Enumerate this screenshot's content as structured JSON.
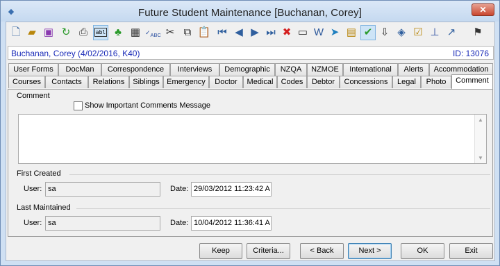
{
  "window": {
    "title": "Future Student Maintenance  [Buchanan, Corey]"
  },
  "toolbar": {
    "icons": [
      "new-document-icon",
      "open-folder-icon",
      "save-icon",
      "refresh-icon",
      "print-icon",
      "abl-icon",
      "tree-icon",
      "calculator-icon",
      "spellcheck-icon",
      "cut-icon",
      "copy-icon",
      "paste-icon",
      "first-record-icon",
      "previous-record-icon",
      "next-record-icon",
      "last-record-icon",
      "delete-icon",
      "card-icon",
      "word-icon",
      "forward-icon",
      "clipboard-icon",
      "approve-icon",
      "download-icon",
      "tag-icon",
      "checklist-icon",
      "pin-icon",
      "link-arrow-icon",
      "flag-icon"
    ],
    "abl_label": "abl"
  },
  "student": {
    "name": "Buchanan, Corey (4/02/2016, K40)",
    "id": "ID: 13076"
  },
  "tabs": {
    "row1": [
      "User Forms",
      "DocMan",
      "Correspondence",
      "Interviews",
      "Demographic",
      "NZQA",
      "NZMOE",
      "International",
      "Alerts",
      "Accommodation"
    ],
    "row2": [
      "Courses",
      "Contacts",
      "Relations",
      "Siblings",
      "Emergency",
      "Doctor",
      "Medical",
      "Codes",
      "Debtor",
      "Concessions",
      "Legal",
      "Photo",
      "Comment"
    ],
    "active": "Comment"
  },
  "comment": {
    "section_label": "Comment",
    "checkbox_label": "Show Important Comments Message",
    "checkbox_checked": false,
    "text": ""
  },
  "first_created": {
    "section_label": "First Created",
    "user_label": "User:",
    "user_value": "sa",
    "date_label": "Date:",
    "date_value": "29/03/2012 11:23:42 A"
  },
  "last_maintained": {
    "section_label": "Last Maintained",
    "user_label": "User:",
    "user_value": "sa",
    "date_label": "Date:",
    "date_value": "10/04/2012 11:36:41 A"
  },
  "buttons": {
    "keep": "Keep",
    "criteria": "Criteria...",
    "back": "< Back",
    "next": "Next >",
    "ok": "OK",
    "exit": "Exit"
  }
}
